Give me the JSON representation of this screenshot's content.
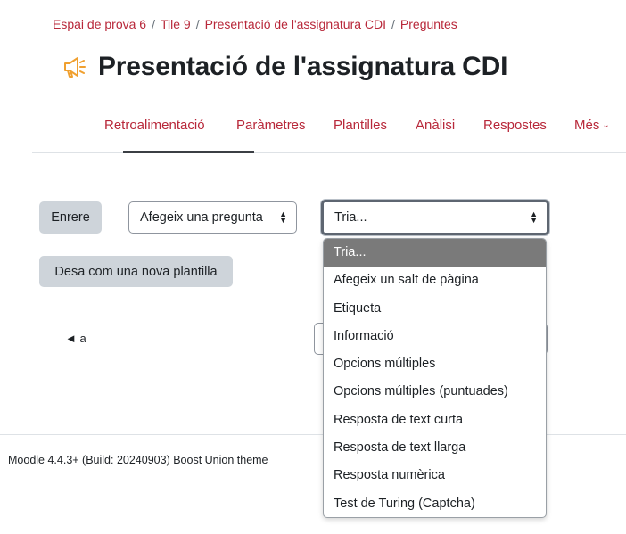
{
  "breadcrumb": {
    "items": [
      "Espai de prova 6",
      "Tile 9",
      "Presentació de l'assignatura CDI",
      "Preguntes"
    ],
    "separator": "/"
  },
  "page": {
    "title": "Presentació de l'assignatura CDI",
    "icon": "megaphone-icon"
  },
  "tabs": {
    "items": [
      "Retroalimentació",
      "Paràmetres",
      "Plantilles",
      "Anàlisi",
      "Respostes",
      "Més"
    ],
    "active": "Retroalimentació"
  },
  "controls": {
    "back_button": "Enrere",
    "add_question_select": "Afegeix una pregunta",
    "type_select_value": "Tria...",
    "save_template_button": "Desa com una nova plantilla",
    "prev_page_link": "◄ a"
  },
  "dropdown": {
    "options": [
      "Tria...",
      "Afegeix un salt de pàgina",
      "Etiqueta",
      "Informació",
      "Opcions múltiples",
      "Opcions múltiples (puntuades)",
      "Resposta de text curta",
      "Resposta de text llarga",
      "Resposta numèrica",
      "Test de Turing (Captcha)"
    ],
    "highlighted": "Tria..."
  },
  "footer": {
    "text": "Moodle 4.4.3+ (Build: 20240903) Boost Union theme"
  },
  "colors": {
    "link": "#b8283a",
    "button_gray": "#ced4da",
    "highlight": "#7a7a7a",
    "icon_orange": "#f0a030"
  }
}
